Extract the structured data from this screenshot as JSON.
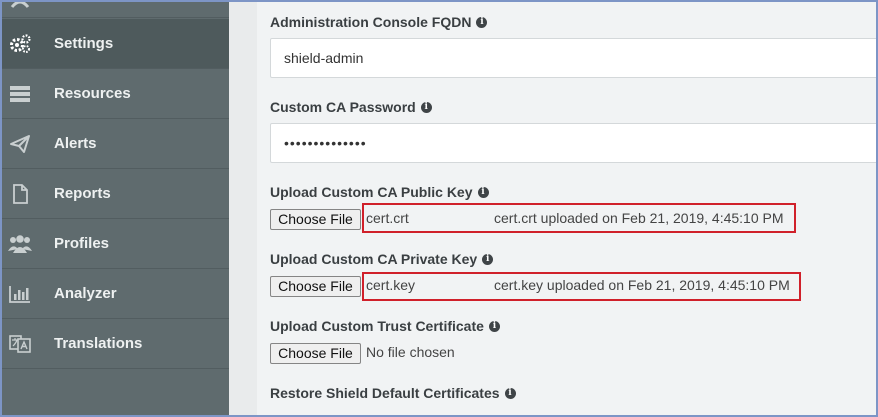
{
  "sidebar": {
    "items": [
      {
        "label": "Settings",
        "icon": "gears-icon",
        "active": true
      },
      {
        "label": "Resources",
        "icon": "server-icon",
        "active": false
      },
      {
        "label": "Alerts",
        "icon": "paper-plane-icon",
        "active": false
      },
      {
        "label": "Reports",
        "icon": "file-icon",
        "active": false
      },
      {
        "label": "Profiles",
        "icon": "users-icon",
        "active": false
      },
      {
        "label": "Analyzer",
        "icon": "bar-chart-icon",
        "active": false
      },
      {
        "label": "Translations",
        "icon": "translate-icon",
        "active": false
      }
    ]
  },
  "form": {
    "fqdn": {
      "label": "Administration Console FQDN",
      "value": "shield-admin"
    },
    "ca_password": {
      "label": "Custom CA Password",
      "value": "••••••••••••••"
    },
    "public_key": {
      "label": "Upload Custom CA Public Key",
      "button": "Choose File",
      "filename": "cert.crt",
      "status": "cert.crt uploaded on Feb 21, 2019, 4:45:10 PM"
    },
    "private_key": {
      "label": "Upload Custom CA Private Key",
      "button": "Choose File",
      "filename": "cert.key",
      "status": "cert.key uploaded on Feb 21, 2019, 4:45:10 PM"
    },
    "trust_cert": {
      "label": "Upload Custom Trust Certificate",
      "button": "Choose File",
      "filename": "No file chosen"
    },
    "restore": {
      "label": "Restore Shield Default Certificates"
    }
  },
  "colors": {
    "sidebar_bg": "#5f6b6e",
    "highlight": "#d0202a",
    "frame": "#7d95c6"
  }
}
